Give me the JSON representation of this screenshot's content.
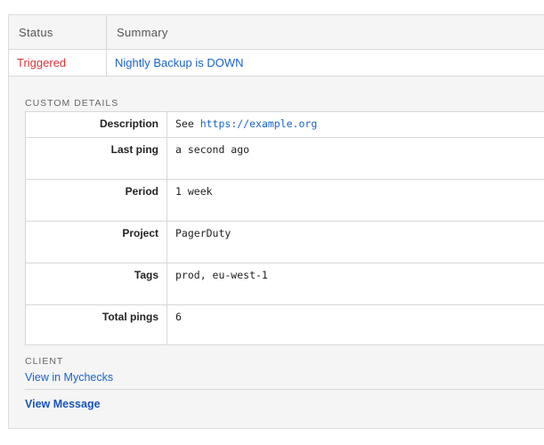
{
  "table": {
    "headers": {
      "status": "Status",
      "summary": "Summary"
    },
    "row": {
      "status": "Triggered",
      "summary": "Nightly Backup is DOWN"
    }
  },
  "custom_details": {
    "title": "CUSTOM DETAILS",
    "description": {
      "key": "Description",
      "prefix": "See ",
      "link": "https://example.org"
    },
    "rows": [
      {
        "key": "Last ping",
        "value": "a second ago"
      },
      {
        "key": "Period",
        "value": "1 week"
      },
      {
        "key": "Project",
        "value": "PagerDuty"
      },
      {
        "key": "Tags",
        "value": "prod, eu-west-1"
      },
      {
        "key": "Total pings",
        "value": "6"
      }
    ]
  },
  "client": {
    "title": "CLIENT",
    "link": "View in Mychecks"
  },
  "actions": {
    "view_message": "View Message"
  },
  "colors": {
    "triggered": "#d6353a",
    "link": "#1a64c8",
    "panel": "#f5f5f5",
    "border": "#d8d8d8"
  }
}
